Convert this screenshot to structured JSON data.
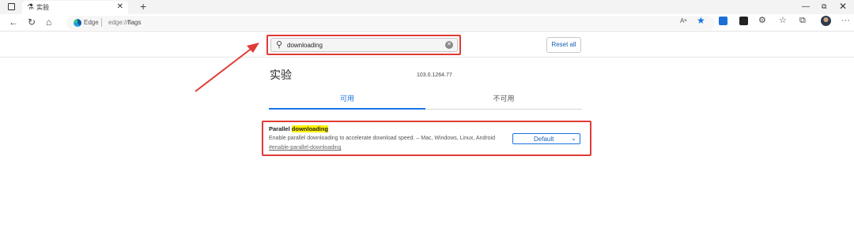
{
  "browser": {
    "tab_title": "实验",
    "tab_icon": "flask-icon",
    "address_brand": "Edge",
    "address_url_prefix": "edge://",
    "address_url_path": "flags"
  },
  "search": {
    "value": "downloading",
    "reset_label": "Reset all"
  },
  "page": {
    "title": "实验",
    "version": "103.0.1264.77"
  },
  "tabs": [
    {
      "label": "可用",
      "active": true
    },
    {
      "label": "不可用",
      "active": false
    }
  ],
  "experiment": {
    "name_prefix": "Parallel ",
    "name_highlight": "downloading",
    "description": "Enable parallel downloading to accelerate download speed. – Mac, Windows, Linux, Android",
    "link": "#enable-parallel-downloading",
    "selected_option": "Default"
  },
  "colors": {
    "accent": "#1a73e8",
    "annotation_red": "#e03b35",
    "highlight_yellow": "#fff200"
  }
}
